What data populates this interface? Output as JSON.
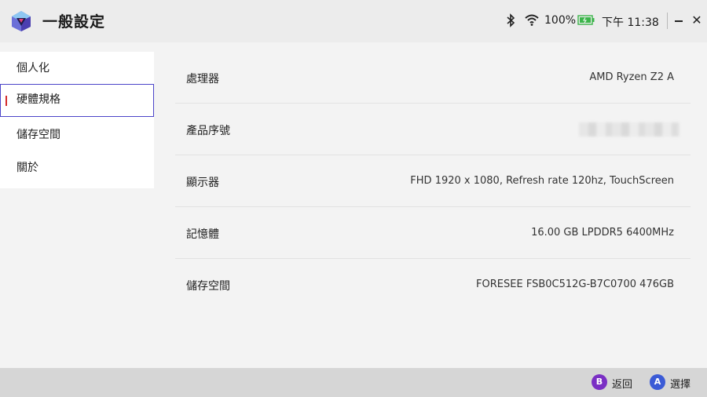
{
  "window": {
    "title": "一般設定",
    "battery_percent": "100%",
    "clock": "下午 11:38",
    "close_glyph": "✕"
  },
  "sidebar": {
    "items": [
      {
        "label": "個人化"
      },
      {
        "label": "硬體規格",
        "selected": true
      },
      {
        "label": "儲存空間"
      },
      {
        "label": "關於"
      }
    ]
  },
  "specs": [
    {
      "label": "處理器",
      "value": "AMD Ryzen Z2 A"
    },
    {
      "label": "產品序號",
      "value": ""
    },
    {
      "label": "顯示器",
      "value": "FHD 1920 x 1080, Refresh rate 120hz, TouchScreen"
    },
    {
      "label": "記憶體",
      "value": "16.00 GB LPDDR5 6400MHz"
    },
    {
      "label": "儲存空間",
      "value": "FORESEE FSB0C512G-B7C0700 476GB"
    }
  ],
  "footer": {
    "back": {
      "key": "B",
      "label": "返回"
    },
    "select": {
      "key": "A",
      "label": "選擇"
    }
  },
  "colors": {
    "accent": "#4b44c9",
    "selection_marker": "#d42b2b",
    "battery_green": "#3bb54a",
    "button_b": "#7a2fc4",
    "button_a": "#3b5bd6"
  },
  "icons": [
    "app-logo-icon",
    "bluetooth-icon",
    "wifi-icon",
    "battery-icon",
    "minimize-icon",
    "close-icon"
  ]
}
